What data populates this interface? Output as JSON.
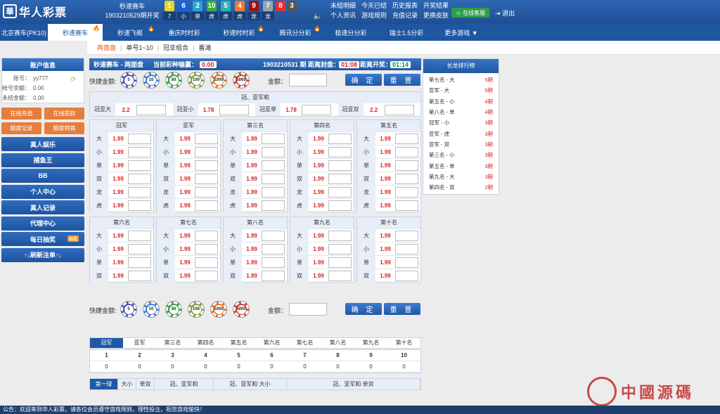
{
  "header": {
    "logo": "华人彩票",
    "game_name": "秒速赛车",
    "period": "1903210529期开奖",
    "balls": [
      {
        "n": "1",
        "c": "#e6d42c"
      },
      {
        "n": "6",
        "c": "#1a5ee0"
      },
      {
        "n": "2",
        "c": "#2aa2d9"
      },
      {
        "n": "10",
        "c": "#36b13c"
      },
      {
        "n": "5",
        "c": "#28b4b4"
      },
      {
        "n": "4",
        "c": "#ee7b2c"
      },
      {
        "n": "9",
        "c": "#a01010"
      },
      {
        "n": "7",
        "c": "#9aa2ab"
      },
      {
        "n": "8",
        "c": "#e03030"
      },
      {
        "n": "3",
        "c": "#555555"
      }
    ],
    "ball_sub": [
      "7",
      "小",
      "单",
      "虎",
      "虎",
      "虎",
      "龙",
      "龙"
    ],
    "links": [
      "未结明细",
      "今天已结",
      "历史报表",
      "开奖结果",
      "个人资讯",
      "游戏规则",
      "充值记录",
      "更换皮肤"
    ],
    "cs": "在线客服",
    "logout": "退出"
  },
  "nav": [
    {
      "label": "北京赛车(PK10)",
      "hot": false,
      "active": false,
      "w": 68
    },
    {
      "label": "秒速赛车",
      "hot": true,
      "active": true,
      "w": 78
    },
    {
      "label": "秒速飞艇",
      "hot": true,
      "active": false,
      "w": 78
    },
    {
      "label": "重庆时时彩",
      "hot": false,
      "active": false,
      "w": 76
    },
    {
      "label": "秒速时时彩",
      "hot": true,
      "active": false,
      "w": 80
    },
    {
      "label": "腾讯分分彩",
      "hot": true,
      "active": false,
      "w": 80
    },
    {
      "label": "极速分分彩",
      "hot": false,
      "active": false,
      "w": 78
    },
    {
      "label": "瑞士1.5分彩",
      "hot": false,
      "active": false,
      "w": 80
    },
    {
      "label": "更多游戏 ▼",
      "hot": false,
      "active": false,
      "w": 76
    }
  ],
  "subnav": [
    "两面盘",
    "单号1~10",
    "冠亚组合",
    "番滩"
  ],
  "account": {
    "title": "账户信息",
    "rows": [
      {
        "k": "账号：",
        "v": "yy777"
      },
      {
        "k": "帐号余额：",
        "v": "0.00"
      },
      {
        "k": "未结金额：",
        "v": "0.00"
      }
    ],
    "btns": [
      "在线充值",
      "在线提款",
      "额度记录",
      "额度转换"
    ],
    "menu": [
      "真人娱乐",
      "捕鱼王",
      "BB",
      "个人中心",
      "真人记录",
      "代理中心",
      "每日抽奖",
      "↑↓刷新注单↑↓"
    ],
    "lottery_tag": "抽奖"
  },
  "bar": {
    "title": "秒速赛车 - 两面盘",
    "win_label": "当前彩种输赢：",
    "win": "0.00",
    "period": "1903210531 期 距离封盘：",
    "close": "01:08",
    "open_label": "距离开奖：",
    "open": "01:14"
  },
  "chips": {
    "label": "快捷金额:",
    "values": [
      "5",
      "10",
      "50",
      "100",
      "1000",
      "5000"
    ],
    "colors": [
      "#4a4ec2",
      "#3b7bd6",
      "#2f9e3f",
      "#7aa12e",
      "#ea6d1e",
      "#d33a2a"
    ],
    "amt": "金额：",
    "ok": "确 定",
    "reset": "重 置"
  },
  "combo": {
    "title": "冠、亚军和",
    "items": [
      {
        "n": "冠亚大",
        "o": "2.2"
      },
      {
        "n": "冠亚小",
        "o": "1.78"
      },
      {
        "n": "冠亚单",
        "o": "1.78"
      },
      {
        "n": "冠亚双",
        "o": "2.2"
      }
    ]
  },
  "tables1": [
    {
      "t": "冠军",
      "rows": [
        [
          "大",
          "1.99"
        ],
        [
          "小",
          "1.99"
        ],
        [
          "单",
          "1.99"
        ],
        [
          "双",
          "1.99"
        ],
        [
          "龙",
          "1.99"
        ],
        [
          "虎",
          "1.99"
        ]
      ]
    },
    {
      "t": "亚军",
      "rows": [
        [
          "大",
          "1.99"
        ],
        [
          "小",
          "1.99"
        ],
        [
          "单",
          "1.99"
        ],
        [
          "双",
          "1.99"
        ],
        [
          "龙",
          "1.99"
        ],
        [
          "虎",
          "1.99"
        ]
      ]
    },
    {
      "t": "第三名",
      "rows": [
        [
          "大",
          "1.99"
        ],
        [
          "小",
          "1.99"
        ],
        [
          "单",
          "1.99"
        ],
        [
          "双",
          "1.99"
        ],
        [
          "龙",
          "1.99"
        ],
        [
          "虎",
          "1.99"
        ]
      ]
    },
    {
      "t": "第四名",
      "rows": [
        [
          "大",
          "1.99"
        ],
        [
          "小",
          "1.99"
        ],
        [
          "单",
          "1.99"
        ],
        [
          "双",
          "1.99"
        ],
        [
          "龙",
          "1.99"
        ],
        [
          "虎",
          "1.99"
        ]
      ]
    },
    {
      "t": "第五名",
      "rows": [
        [
          "大",
          "1.99"
        ],
        [
          "小",
          "1.99"
        ],
        [
          "单",
          "1.99"
        ],
        [
          "双",
          "1.99"
        ],
        [
          "龙",
          "1.99"
        ],
        [
          "虎",
          "1.99"
        ]
      ]
    }
  ],
  "tables2": [
    {
      "t": "第六名",
      "rows": [
        [
          "大",
          "1.99"
        ],
        [
          "小",
          "1.99"
        ],
        [
          "单",
          "1.99"
        ],
        [
          "双",
          "1.99"
        ]
      ]
    },
    {
      "t": "第七名",
      "rows": [
        [
          "大",
          "1.99"
        ],
        [
          "小",
          "1.99"
        ],
        [
          "单",
          "1.99"
        ],
        [
          "双",
          "1.99"
        ]
      ]
    },
    {
      "t": "第八名",
      "rows": [
        [
          "大",
          "1.99"
        ],
        [
          "小",
          "1.99"
        ],
        [
          "单",
          "1.99"
        ],
        [
          "双",
          "1.99"
        ]
      ]
    },
    {
      "t": "第九名",
      "rows": [
        [
          "大",
          "1.99"
        ],
        [
          "小",
          "1.99"
        ],
        [
          "单",
          "1.99"
        ],
        [
          "双",
          "1.99"
        ]
      ]
    },
    {
      "t": "第十名",
      "rows": [
        [
          "大",
          "1.99"
        ],
        [
          "小",
          "1.99"
        ],
        [
          "单",
          "1.99"
        ],
        [
          "双",
          "1.99"
        ]
      ]
    }
  ],
  "results": {
    "tabs": [
      "冠军",
      "亚军",
      "第三名",
      "第四名",
      "第五名",
      "第六名",
      "第七名",
      "第八名",
      "第九名",
      "第十名"
    ],
    "nums": [
      "1",
      "2",
      "3",
      "4",
      "5",
      "6",
      "7",
      "8",
      "9",
      "10"
    ],
    "counts": [
      "0",
      "0",
      "0",
      "0",
      "0",
      "0",
      "0",
      "0",
      "0",
      "0"
    ]
  },
  "bottom_tabs": [
    {
      "l": "第一球",
      "w": 40
    },
    {
      "l": "大小",
      "w": 26
    },
    {
      "l": "单双",
      "w": 26
    },
    {
      "l": "冠、亚军和",
      "w": 84
    },
    {
      "l": "冠、亚军和 大小",
      "w": 104
    },
    {
      "l": "冠、亚军和 单双",
      "w": 190
    }
  ],
  "rank": {
    "title": "长龙排行榜",
    "rows": [
      [
        "第七名 - 大",
        "5期"
      ],
      [
        "亚军 - 大",
        "5期"
      ],
      [
        "第五名 - 小",
        "4期"
      ],
      [
        "第八名 - 单",
        "4期"
      ],
      [
        "冠军 - 小",
        "3期"
      ],
      [
        "亚军 - 虎",
        "3期"
      ],
      [
        "亚军 - 双",
        "3期"
      ],
      [
        "第三名 - 小",
        "3期"
      ],
      [
        "第五名 - 单",
        "3期"
      ],
      [
        "第九名 - 大",
        "3期"
      ],
      [
        "第四名 - 双",
        "2期"
      ]
    ]
  },
  "marquee": "公告：欢迎来到华人彩票，请各位会员遵守游戏规则，理性投注，祝您游戏愉快！",
  "watermark": "中國源碼"
}
